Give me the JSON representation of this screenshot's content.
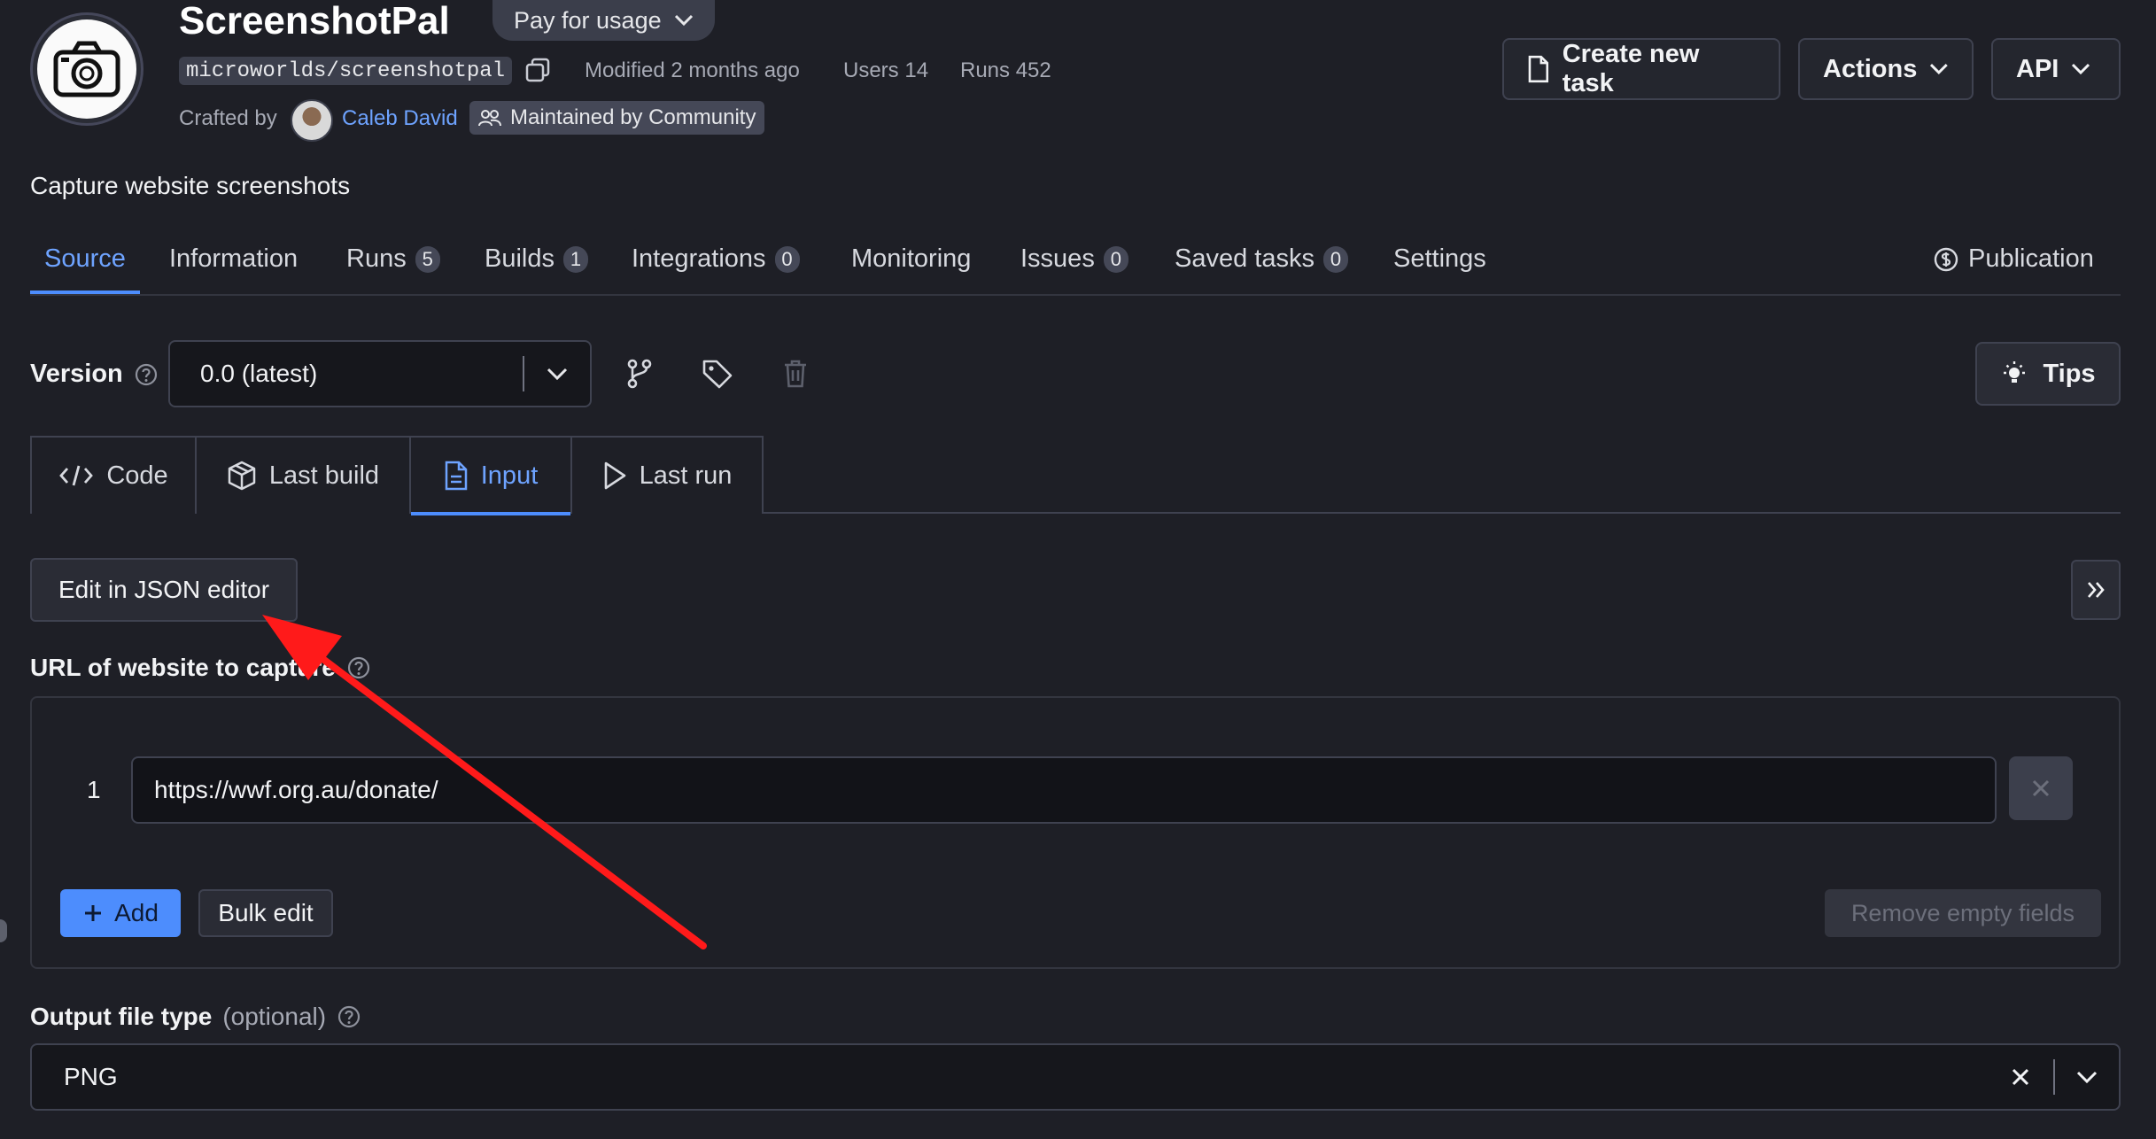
{
  "header": {
    "title": "ScreenshotPal",
    "pricing": "Pay for usage",
    "slug": "microworlds/screenshotpal",
    "modified": "Modified 2 months ago",
    "users": "Users 14",
    "runs": "Runs 452",
    "crafted_by": "Crafted by",
    "author": "Caleb David",
    "maintained": "Maintained by Community",
    "create_task": "Create new task",
    "actions": "Actions",
    "api": "API"
  },
  "description": "Capture website screenshots",
  "nav": {
    "tabs": [
      {
        "label": "Source"
      },
      {
        "label": "Information"
      },
      {
        "label": "Runs",
        "badge": "5"
      },
      {
        "label": "Builds",
        "badge": "1"
      },
      {
        "label": "Integrations",
        "badge": "0"
      },
      {
        "label": "Monitoring"
      },
      {
        "label": "Issues",
        "badge": "0"
      },
      {
        "label": "Saved tasks",
        "badge": "0"
      },
      {
        "label": "Settings"
      }
    ],
    "publication": "Publication"
  },
  "version": {
    "label": "Version",
    "value": "0.0 (latest)",
    "tips": "Tips"
  },
  "source_tabs": [
    {
      "label": "Code"
    },
    {
      "label": "Last build"
    },
    {
      "label": "Input"
    },
    {
      "label": "Last run"
    }
  ],
  "input": {
    "json_editor": "Edit in JSON editor",
    "url_label": "URL of website to capture",
    "url_index": "1",
    "url_value": "https://wwf.org.au/donate/",
    "add": "Add",
    "bulk_edit": "Bulk edit",
    "remove_empty": "Remove empty fields",
    "output_label": "Output file type",
    "output_optional": "(optional)",
    "output_value": "PNG"
  },
  "colors": {
    "background": "#1e1f26",
    "accent": "#4d8dfd",
    "link": "#6ea3ff",
    "annotation_arrow": "#ff1a1a"
  }
}
